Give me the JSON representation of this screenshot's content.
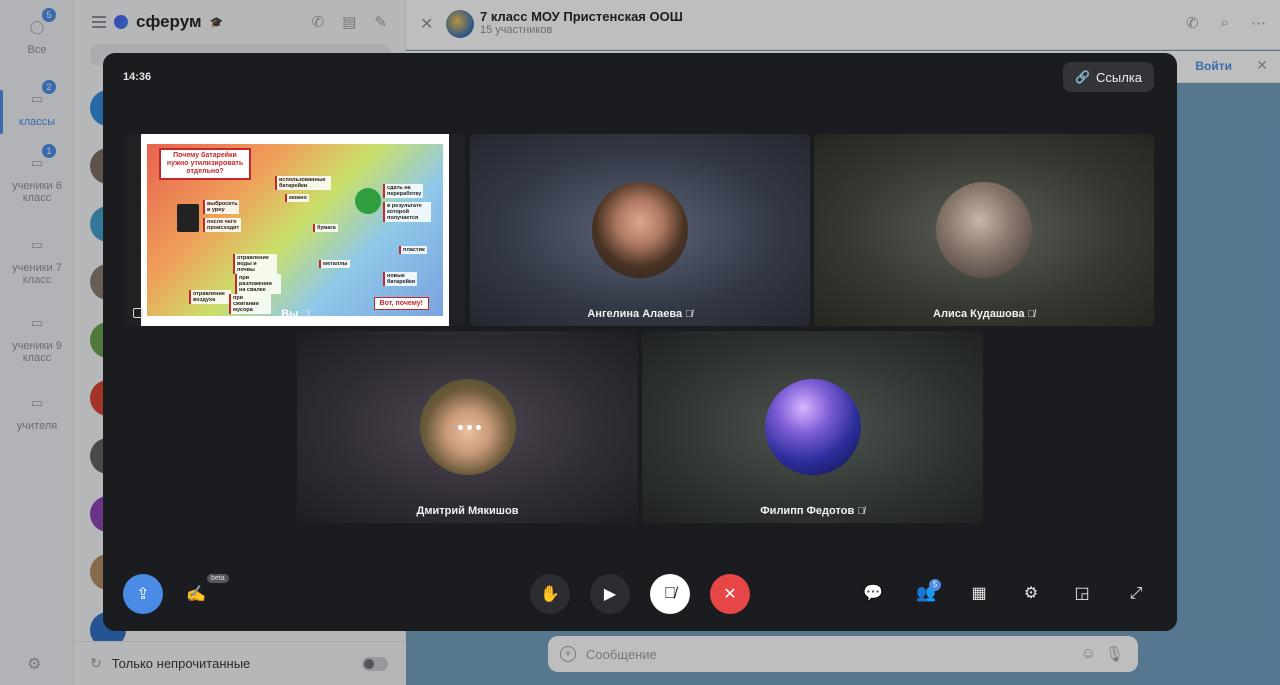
{
  "rail": {
    "items": [
      {
        "label": "Все",
        "badge": "5"
      },
      {
        "label": "классы",
        "badge": "2"
      },
      {
        "label": "ученики 6 класс",
        "badge": "1"
      },
      {
        "label": "ученики 7 класс",
        "badge": ""
      },
      {
        "label": "ученики 9 класс",
        "badge": ""
      },
      {
        "label": "учителя",
        "badge": ""
      }
    ]
  },
  "chatlist": {
    "brand": "сферум",
    "unread_filter_label": "Только непрочитанные"
  },
  "conversation": {
    "title": "7 класс МОУ Пристенская ООШ",
    "subtitle": "15 участников",
    "pin_action": "Войти",
    "message_placeholder": "Сообщение"
  },
  "call": {
    "time": "14:36",
    "link_label": "Ссылка",
    "beta_label": "beta",
    "participants_count": "5",
    "self_label": "Вы",
    "participants": [
      {
        "name": "Ангелина Алаева",
        "muted": true
      },
      {
        "name": "Алиса Кудашова",
        "muted": true
      },
      {
        "name": "Дмитрий Мякишов",
        "muted": false
      },
      {
        "name": "Филипп Федотов",
        "muted": true
      }
    ],
    "slide": {
      "title": "Почему батарейки нужно утилизировать отдельно?",
      "labels": [
        "использованные батарейки",
        "можно",
        "выбросить в урну",
        "после чего происходит",
        "сдать на переработку",
        "в результате которой получается",
        "бумага",
        "пластик",
        "металлы",
        "новые батарейки",
        "отравление воды и почвы",
        "при разложении на свалке",
        "отравление воздуха",
        "при сжигании мусора"
      ],
      "button": "Вот, почему!"
    }
  },
  "colors": {
    "accent": "#4a8be6",
    "end_call": "#e64646",
    "call_bg": "#1b1c1f"
  }
}
